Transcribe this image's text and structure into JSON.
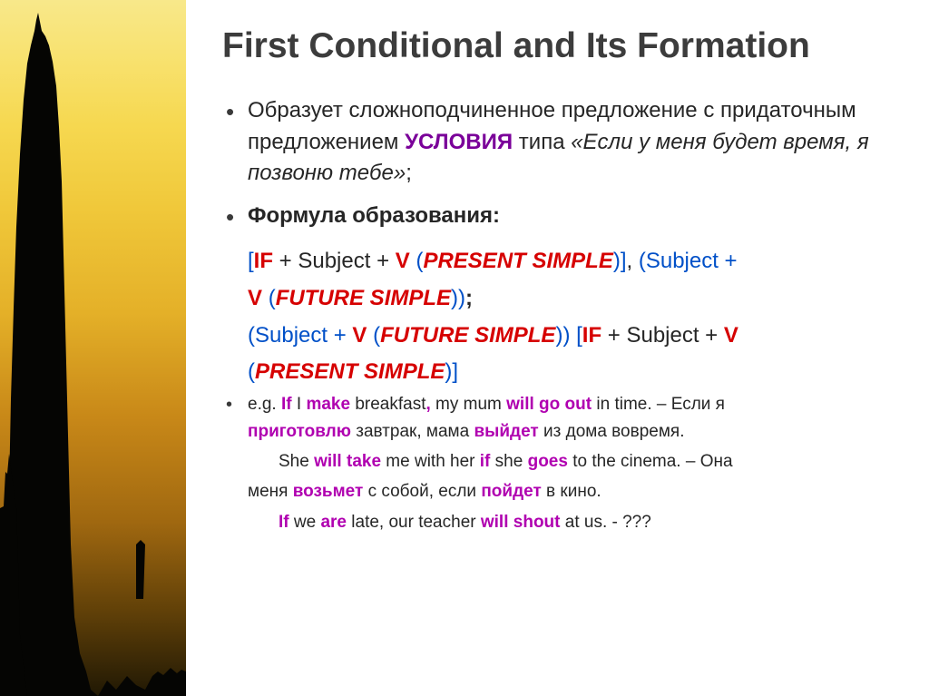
{
  "title": "First Conditional and Its Formation",
  "bullet1": {
    "pre": "Образует сложноподчиненное предложение с придаточным предложением ",
    "cond": "УСЛОВИЯ",
    "post": " типа ",
    "quote": "«Если у меня будет время, я позвоню тебе»",
    "semi": ";"
  },
  "bullet2": "Формула образования:",
  "formula": {
    "if": "IF",
    "subj": " + Subject + ",
    "v": "V",
    "open_sq": "[",
    "close_sq": "]",
    "open_par": "(",
    "close_par": ")",
    "present": "PRESENT SIMPLE",
    "future": "FUTURE SIMPLE",
    "comma": ", ",
    "semi": ";",
    "subj_plus": "(Subject + "
  },
  "ex1": {
    "eg": "e.g. ",
    "if": "If",
    "sp": " ",
    "i": "I ",
    "make": "make",
    "mid1": " breakfast",
    "comma": ", ",
    "mum": "my mum ",
    "willgo": "will go out",
    "end": " in time. – Если я",
    "ru1a": "приготовлю",
    "ru1b": " завтрак, мама ",
    "ru1c": "выйдет",
    "ru1d": " из дома вовремя."
  },
  "ex2": {
    "she": "She ",
    "willtake": "will take",
    "mid": " me with her ",
    "if": "if",
    "sp": " ",
    "she2": "she ",
    "goes": "goes",
    "end": " to the cinema. – Она",
    "ru2a": "меня ",
    "ru2b": "возьмет",
    "ru2c": " с собой, если ",
    "ru2d": "пойдет",
    "ru2e": " в кино."
  },
  "ex3": {
    "if": "If",
    "sp": " ",
    "we": "we ",
    "are": "are",
    "mid": " late, our teacher ",
    "willshout": "will shout",
    "end": " at us. - ???"
  }
}
